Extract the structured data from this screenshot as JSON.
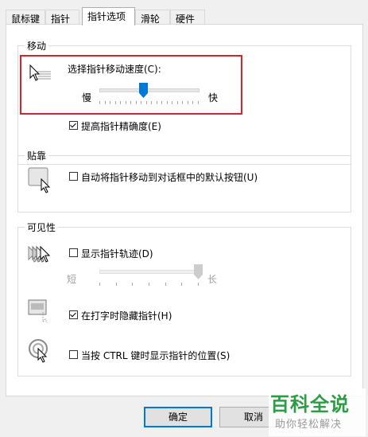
{
  "tabs": [
    "鼠标键",
    "指针",
    "指针选项",
    "滑轮",
    "硬件"
  ],
  "motion": {
    "legend": "移动",
    "speed_label": "选择指针移动速度(C):",
    "slow": "慢",
    "fast": "快",
    "speed_level": 0.45,
    "precision_label": "提高指针精确度(E)",
    "precision_checked": true
  },
  "snap": {
    "legend": "贴靠",
    "label": "自动将指针移动到对话框中的默认按钮(U)",
    "checked": false
  },
  "visibility": {
    "legend": "可见性",
    "trails_label": "显示指针轨迹(D)",
    "trails_checked": false,
    "short": "短",
    "long": "长",
    "trails_level": 1.0,
    "hide_label": "在打字时隐藏指针(H)",
    "hide_checked": true,
    "ctrl_label": "当按 CTRL 键时显示指针的位置(S)",
    "ctrl_checked": false
  },
  "buttons": {
    "ok": "确定",
    "cancel": "取消"
  },
  "watermark": {
    "title": "百科全说",
    "subtitle": "助你轻松解决"
  },
  "colors": {
    "accent": "#0078d7",
    "highlight": "#d9232b",
    "watermark": "#2e9c44"
  }
}
